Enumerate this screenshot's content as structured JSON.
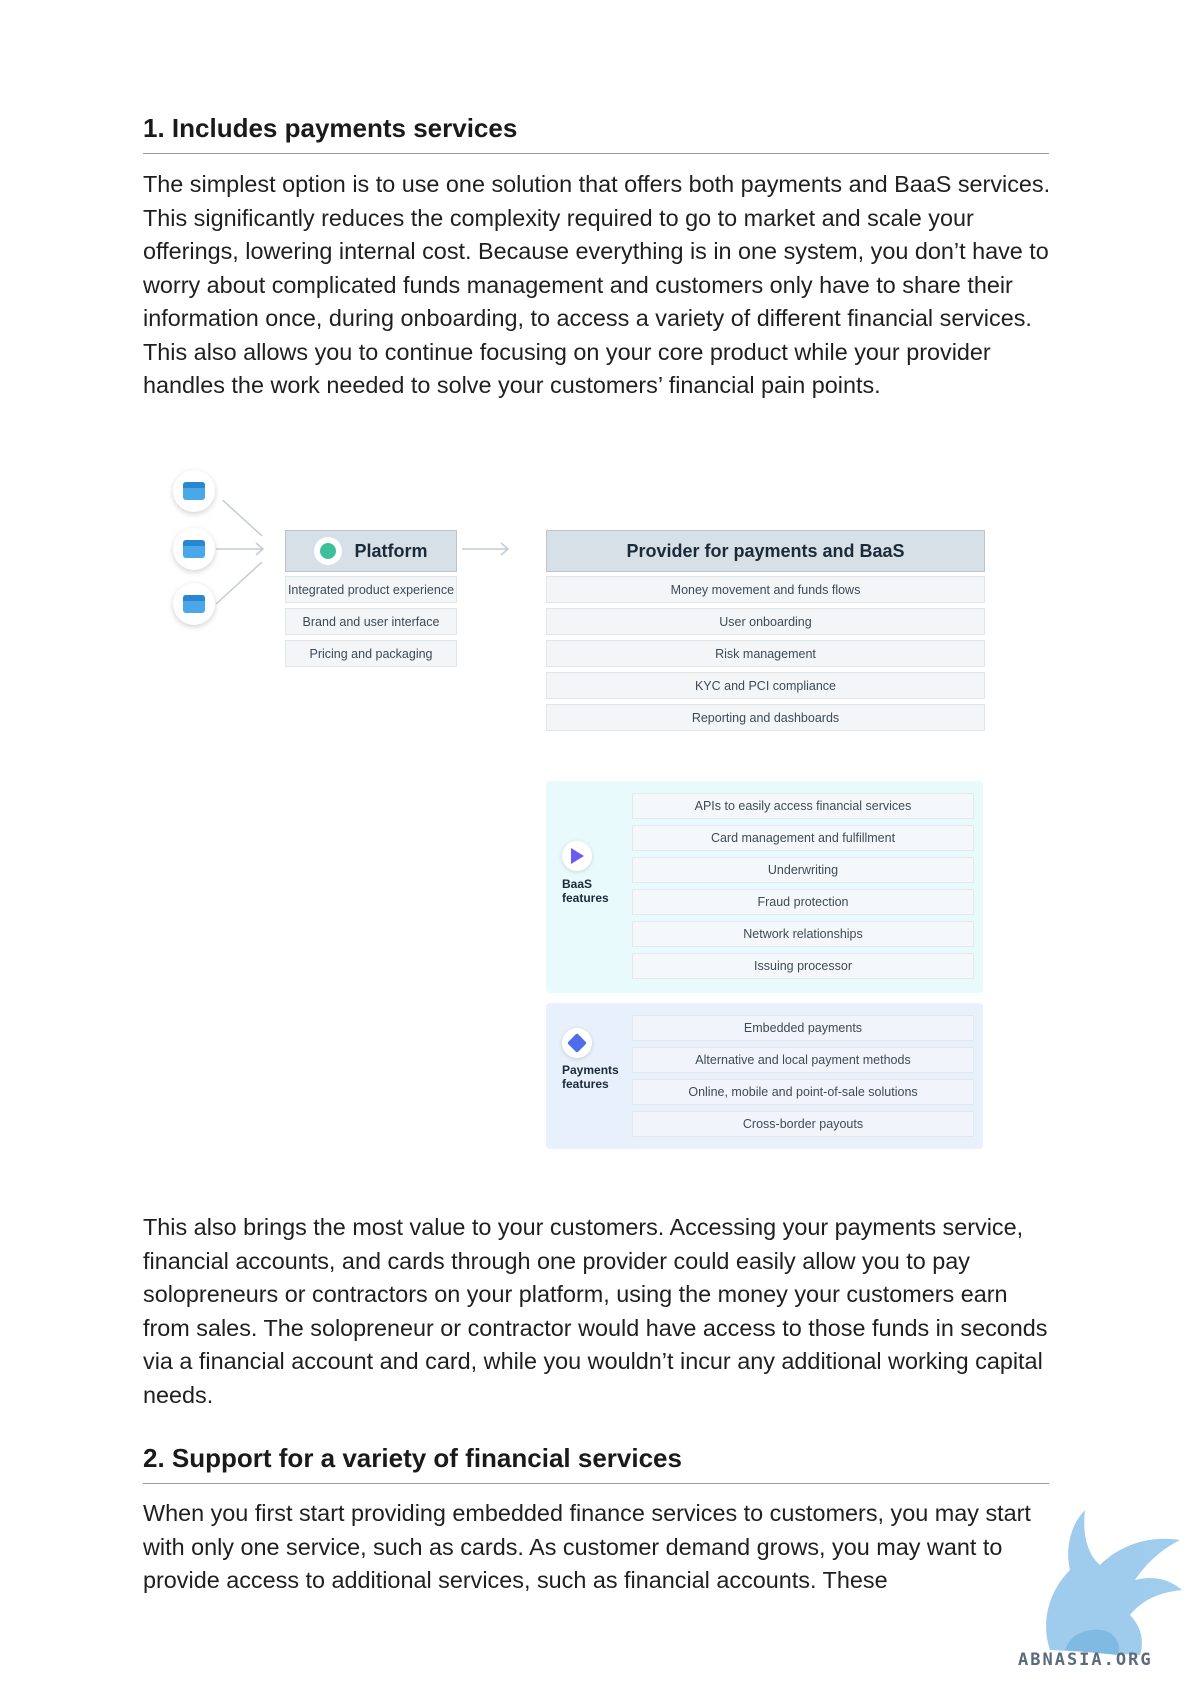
{
  "section1": {
    "heading": "1. Includes payments services",
    "paragraph1": "The simplest option is to use one solution that offers both payments and BaaS services. This significantly reduces the complexity required to go to market and scale your offerings, lowering internal cost. Because everything is in one system, you don’t have to worry about complicated funds management and customers only have to share their information once, during onboarding, to access a variety of different financial services. This also allows you to continue focusing on your core product while your provider handles the work needed to solve your customers’ financial pain points.",
    "paragraph2": "This also brings the most value to your customers. Accessing your payments service, financial accounts, and cards through one provider could easily allow you to pay solopreneurs or contractors on your platform, using the money your customers earn from sales. The solopreneur or contractor would have access to those funds in seconds via a financial account and card, while you wouldn’t incur any additional working capital needs."
  },
  "diagram": {
    "icons": [
      "store-icon",
      "store-icon",
      "store-icon"
    ],
    "platform": {
      "title": "Platform",
      "items": [
        "Integrated product experience",
        "Brand and user interface",
        "Pricing and packaging"
      ]
    },
    "provider": {
      "title": "Provider for payments and BaaS",
      "items": [
        "Money movement and funds flows",
        "User onboarding",
        "Risk management",
        "KYC and PCI compliance",
        "Reporting and dashboards"
      ]
    },
    "baas": {
      "label_line1": "BaaS",
      "label_line2": "features",
      "items": [
        "APIs to easily access financial services",
        "Card management and fulfillment",
        "Underwriting",
        "Fraud protection",
        "Network relationships",
        "Issuing processor"
      ]
    },
    "payments": {
      "label_line1": "Payments",
      "label_line2": "features",
      "items": [
        "Embedded payments",
        "Alternative and local payment methods",
        "Online, mobile and point-of-sale solutions",
        "Cross-border payouts"
      ]
    },
    "colors": {
      "accent_teal": "#3dbf9a",
      "baas_panel": "#e9fafc",
      "payments_panel": "#e8f0fb",
      "header_box": "#d8e0e7"
    }
  },
  "section2": {
    "heading": "2. Support for a variety of financial services",
    "paragraph": "When you first start providing embedded finance services to customers, you may start with only one service, such as cards. As customer demand grows, you may want to provide access to additional services, such as financial accounts. These"
  },
  "watermark": {
    "text": "ABNASIA.ORG"
  }
}
